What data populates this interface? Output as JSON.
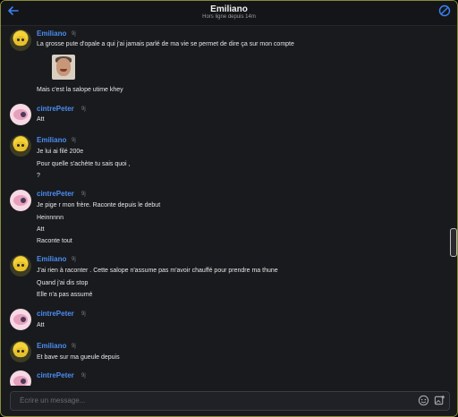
{
  "header": {
    "title": "Emiliano",
    "subtitle": "Hors ligne depuis 14m"
  },
  "colors": {
    "accent": "#3b82f6",
    "name_emiliano": "#4a8df2",
    "name_cintre": "#4a8df2",
    "background": "#191a1d"
  },
  "messages": [
    {
      "author": "Emiliano",
      "time": "9j",
      "avatar": "emiliano-avatar",
      "lines": [
        "La grosse pute d'opale a qui j'ai jamais parlé de ma vie se permet de dire ça sur mon compte"
      ],
      "sticker": "risitas-sticker",
      "after_lines": [
        "Mais c'est la salope utime khey"
      ]
    },
    {
      "author": "cintrePeter",
      "time": "9j",
      "avatar": "cintrepeter-avatar",
      "lines": [
        "Att"
      ]
    },
    {
      "author": "Emiliano",
      "time": "9j",
      "avatar": "emiliano-avatar",
      "lines": [
        "Je lui ai filé 200e",
        "Pour quelle s'achète tu sais quoi ,",
        "?"
      ]
    },
    {
      "author": "cintrePeter",
      "time": "9j",
      "avatar": "cintrepeter-avatar",
      "lines": [
        "Je pige r mon frère. Raconte depuis le debut",
        "Heinnnnn",
        "Att",
        "Raconte tout"
      ]
    },
    {
      "author": "Emiliano",
      "time": "9j",
      "avatar": "emiliano-avatar",
      "lines": [
        "J'ai rien à raconter . Cette salope n'assume pas m'avoir chauffé pour prendre ma thune",
        "Quand j'ai dis stop",
        "Elle n'a pas assumé"
      ]
    },
    {
      "author": "cintrePeter",
      "time": "9j",
      "avatar": "cintrepeter-avatar",
      "lines": [
        "Att"
      ]
    },
    {
      "author": "Emiliano",
      "time": "9j",
      "avatar": "emiliano-avatar",
      "lines": [
        "Et bave sur ma gueule depuis"
      ]
    },
    {
      "author": "cintrePeter",
      "time": "9j",
      "avatar": "cintrepeter-avatar",
      "lines": []
    }
  ],
  "composer": {
    "placeholder": "Écrire un message...",
    "value": ""
  },
  "icons": {
    "back": "arrow-left-icon",
    "block": "block-icon",
    "emoji": "emoji-icon",
    "attach": "image-add-icon"
  }
}
